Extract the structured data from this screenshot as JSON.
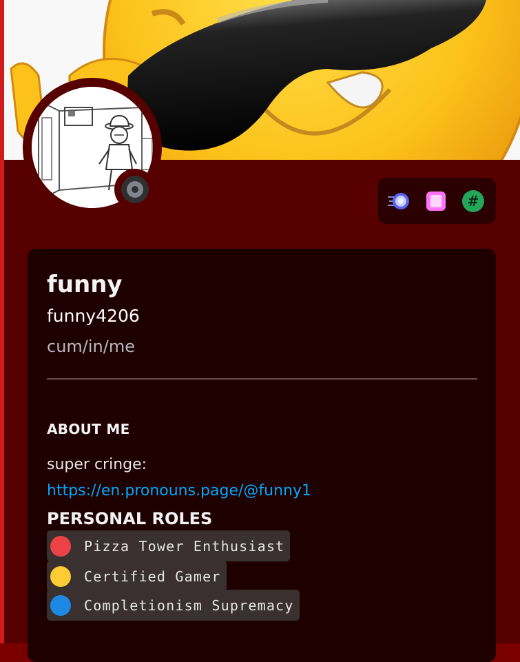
{
  "profile": {
    "display_name": "funny",
    "username": "funny4206",
    "pronouns": "cum/in/me"
  },
  "status": {
    "icon": "offline-status-icon",
    "color": "#80848e"
  },
  "badges": [
    {
      "icon": "hypesquad-badge-icon"
    },
    {
      "icon": "nitro-badge-icon"
    },
    {
      "icon": "hashtag-badge-icon",
      "glyph": "#"
    }
  ],
  "about": {
    "heading": "ABOUT ME",
    "text": "super cringe:",
    "link": "https://en.pronouns.page/@funny1"
  },
  "roles": {
    "heading": "PERSONAL ROLES",
    "items": [
      {
        "label": "Pizza Tower Enthusiast",
        "color": "#ed4245"
      },
      {
        "label": "Certified Gamer",
        "color": "#fdcb33"
      },
      {
        "label": "Completionism Supremacy",
        "color": "#1e88e5"
      }
    ]
  },
  "colors": {
    "profile_background": "#560000",
    "card_background": "#1f0000",
    "link": "#00a8fc",
    "accent_edge": "#cf1b1b"
  }
}
